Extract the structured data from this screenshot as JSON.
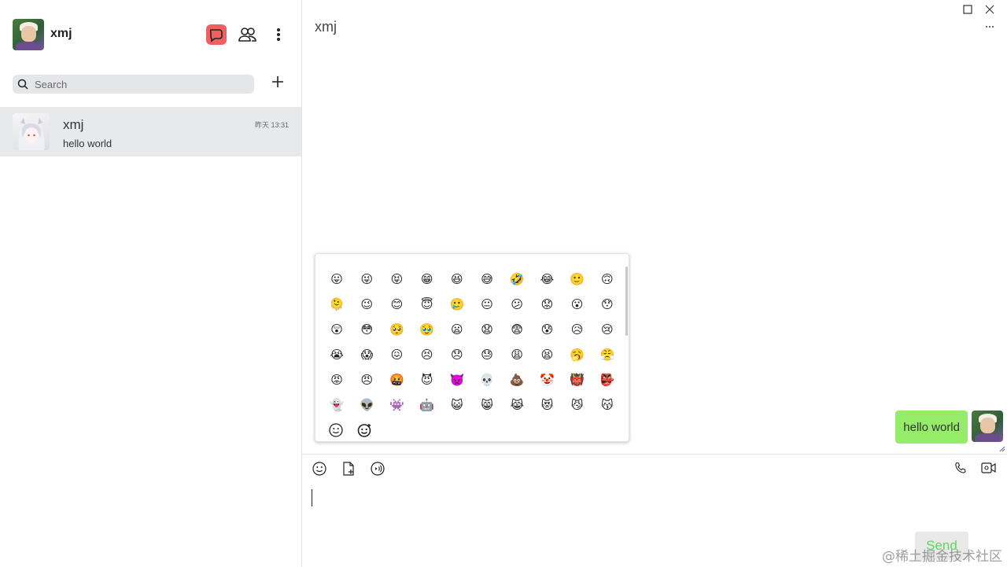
{
  "sidebar": {
    "user_name": "xmj",
    "search": {
      "placeholder": "Search",
      "value": ""
    },
    "conversations": [
      {
        "name": "xmj",
        "last_message": "hello world",
        "time": "昨天 13:31"
      }
    ]
  },
  "chat": {
    "title": "xmj",
    "messages": [
      {
        "text": "hello world",
        "from_me": true
      }
    ],
    "input_value": "",
    "send_label": "Send"
  },
  "emoji_picker": {
    "emojis": [
      "😛",
      "😜",
      "😝",
      "😁",
      "😆",
      "😅",
      "🤣",
      "😂",
      "🙂",
      "🙃",
      "🫠",
      "😉",
      "😊",
      "😇",
      "🥲",
      "😐",
      "😕",
      "😟",
      "😮",
      "😯",
      "😲",
      "😳",
      "🥺",
      "🥹",
      "😦",
      "😧",
      "😨",
      "😰",
      "😥",
      "😢",
      "😭",
      "😱",
      "😖",
      "😣",
      "😞",
      "😓",
      "😩",
      "😫",
      "🥱",
      "😤",
      "😡",
      "😠",
      "🤬",
      "😈",
      "👿",
      "💀",
      "💩",
      "🤡",
      "👹",
      "👺",
      "👻",
      "👽",
      "👾",
      "🤖",
      "😺",
      "😸",
      "😹",
      "😻",
      "😼",
      "😽"
    ],
    "tabs": [
      "smile-face-tab",
      "sparkle-face-tab"
    ]
  },
  "watermark": "@稀土掘金技术社区",
  "colors": {
    "bubble": "#95ec69",
    "send_text": "#5bd85b",
    "accent_red": "#f05a5a"
  }
}
